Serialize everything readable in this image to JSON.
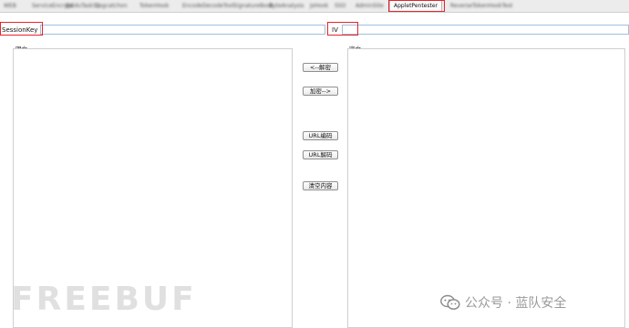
{
  "tabs": [
    {
      "label": "WEB"
    },
    {
      "label": "ServiceEncrypt"
    },
    {
      "label": "BaiduTaskSS"
    },
    {
      "label": "Logcatchon"
    },
    {
      "label": "TokenHook"
    },
    {
      "label": "EncodeDecodeTool"
    },
    {
      "label": "SignatureBook"
    },
    {
      "label": "ByteAnalysis"
    },
    {
      "label": "JsHook"
    },
    {
      "label": "SSO"
    },
    {
      "label": "AdminSite"
    },
    {
      "label": "AppletPentester"
    },
    {
      "label": "ReverseTokenHookTest"
    }
  ],
  "active_tab": "AppletPentester",
  "session_key": {
    "label": "SessionKey",
    "value": ""
  },
  "iv": {
    "label": "IV",
    "value": ""
  },
  "plaintext_panel": {
    "label": "明文",
    "value": ""
  },
  "ciphertext_panel": {
    "label": "密文",
    "value": ""
  },
  "buttons": {
    "decrypt": "<--解密",
    "encrypt": "加密-->",
    "url_encode": "URL编码",
    "url_decode": "URL解码",
    "clear": "清空内容"
  },
  "watermark": {
    "freebuf": "FREEBUF",
    "wechat": "公众号 · 蓝队安全"
  },
  "colors": {
    "highlight": "#e8232b",
    "input_border": "#9ec0dc"
  }
}
